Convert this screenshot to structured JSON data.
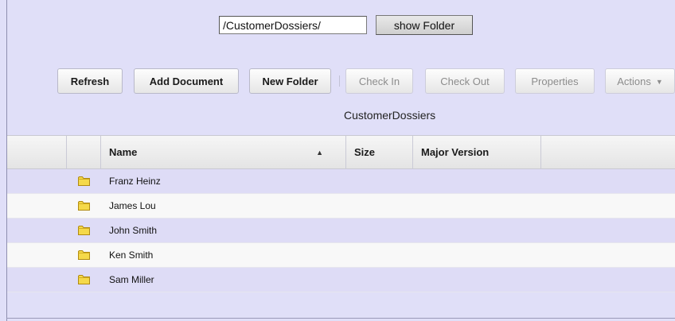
{
  "path_field": {
    "value": "/CustomerDossiers/"
  },
  "show_folder_label": "show Folder",
  "toolbar": {
    "refresh": "Refresh",
    "add_document": "Add Document",
    "new_folder": "New Folder",
    "check_in": "Check In",
    "check_out": "Check Out",
    "properties": "Properties",
    "actions": "Actions"
  },
  "table_title": "CustomerDossiers",
  "columns": {
    "name": "Name",
    "size": "Size",
    "major_version": "Major Version"
  },
  "rows": [
    {
      "name": "Franz Heinz",
      "icon": "folder-icon"
    },
    {
      "name": "James Lou",
      "icon": "folder-icon"
    },
    {
      "name": "John Smith",
      "icon": "folder-icon"
    },
    {
      "name": "Ken Smith",
      "icon": "folder-icon"
    },
    {
      "name": "Sam Miller",
      "icon": "folder-icon"
    }
  ],
  "colors": {
    "background": "#e0dff8",
    "row_alt": "#dedcf6",
    "folder": "#f5d94a"
  }
}
